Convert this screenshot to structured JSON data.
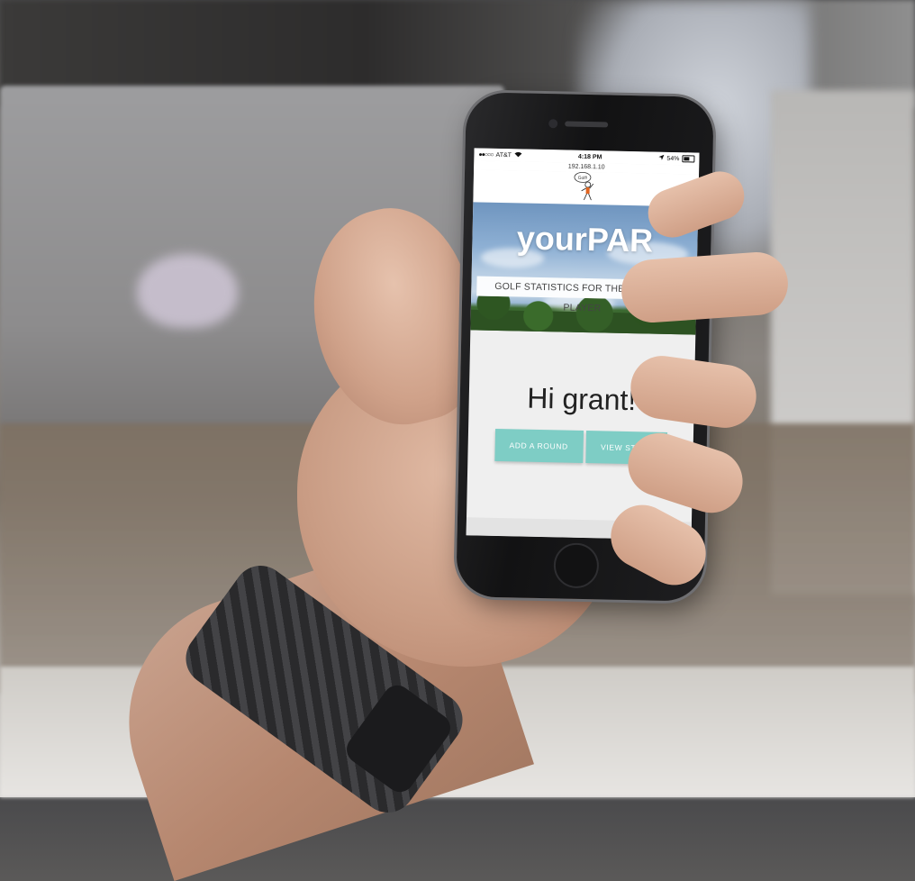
{
  "status_bar": {
    "carrier": "AT&T",
    "signal": "●●○○○",
    "time": "4:18 PM",
    "battery": "54%",
    "location_icon": "location-arrow-icon"
  },
  "url": "192.168.1.10",
  "site": {
    "logo_alt": "golfer-mascot",
    "logo_text": "Golf!",
    "brand": "yourPAR",
    "tagline": "GOLF STATISTICS FOR THE MODERN PLAYER"
  },
  "main": {
    "greeting": "Hi grant!",
    "add_round_label": "ADD A ROUND",
    "view_stats_label": "VIEW STATS"
  },
  "colors": {
    "accent_button": "#7ecdc5",
    "brand_text": "#ffffff"
  }
}
